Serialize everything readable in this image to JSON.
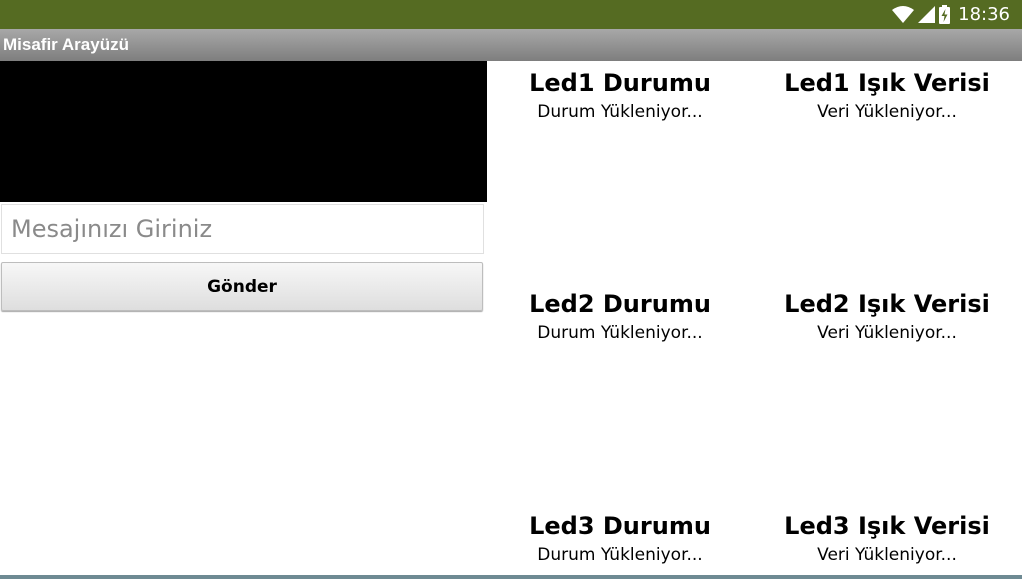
{
  "status_bar": {
    "time": "18:36",
    "icons": [
      "wifi-icon",
      "signal-icon",
      "battery-charging-icon"
    ],
    "background_color": "#556b22"
  },
  "app": {
    "title": "Misafir Arayüzü"
  },
  "form": {
    "message_placeholder": "Mesajınızı Giriniz",
    "message_value": "",
    "send_label": "Gönder"
  },
  "leds": [
    {
      "status_title": "Led1 Durumu",
      "status_value": "Durum Yükleniyor...",
      "light_title": "Led1 Işık Verisi",
      "light_value": "Veri Yükleniyor..."
    },
    {
      "status_title": "Led2 Durumu",
      "status_value": "Durum Yükleniyor...",
      "light_title": "Led2 Işık Verisi",
      "light_value": "Veri Yükleniyor..."
    },
    {
      "status_title": "Led3 Durumu",
      "status_value": "Durum Yükleniyor...",
      "light_title": "Led3 Işık Verisi",
      "light_value": "Veri Yükleniyor..."
    }
  ]
}
